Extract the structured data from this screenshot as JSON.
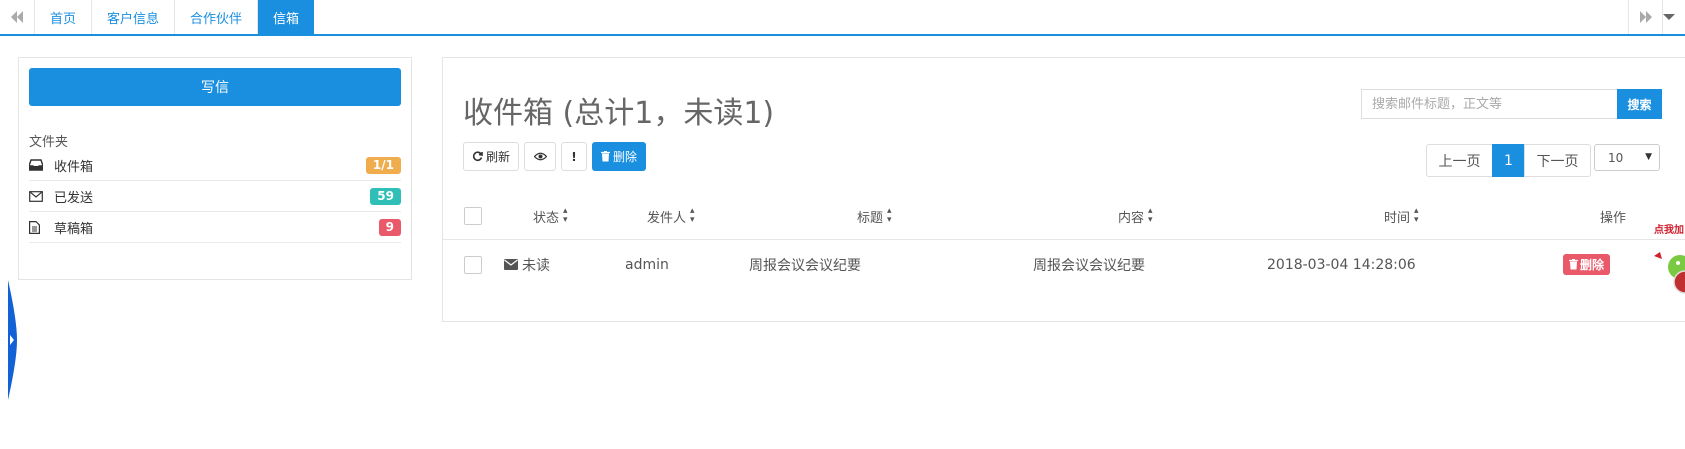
{
  "tabbar": {
    "tabs": [
      {
        "label": "首页",
        "active": false
      },
      {
        "label": "客户信息",
        "active": false
      },
      {
        "label": "合作伙伴",
        "active": false
      },
      {
        "label": "信箱",
        "active": true
      }
    ]
  },
  "sidebar": {
    "compose_label": "写信",
    "folder_heading": "文件夹",
    "folders": [
      {
        "label": "收件箱",
        "badge": "1/1",
        "badge_color": "#f0ad4e",
        "icon": "inbox-icon"
      },
      {
        "label": "已发送",
        "badge": "59",
        "badge_color": "#2fbfb6",
        "icon": "envelope-icon"
      },
      {
        "label": "草稿箱",
        "badge": "9",
        "badge_color": "#e9596a",
        "icon": "file-icon"
      }
    ]
  },
  "main": {
    "title": "收件箱 (总计1，未读1)",
    "search": {
      "placeholder": "搜索邮件标题，正文等",
      "button_label": "搜索"
    },
    "toolbar": {
      "refresh_label": "刷新",
      "delete_label": "删除"
    },
    "pager": {
      "prev_label": "上一页",
      "current_page": "1",
      "next_label": "下一页",
      "page_size": "10"
    },
    "table": {
      "headers": {
        "status": "状态",
        "sender": "发件人",
        "subject": "标题",
        "content": "内容",
        "time": "时间",
        "actions": "操作"
      },
      "rows": [
        {
          "status": "未读",
          "sender": "admin",
          "subject": "周报会议会议纪要",
          "content": "周报会议会议纪要",
          "time": "2018-03-04 14:28:06",
          "action": "删除"
        }
      ]
    }
  },
  "corner_widget": {
    "label": "点我加"
  },
  "colors": {
    "accent": "#1a8fe0",
    "danger": "#e9596a"
  }
}
